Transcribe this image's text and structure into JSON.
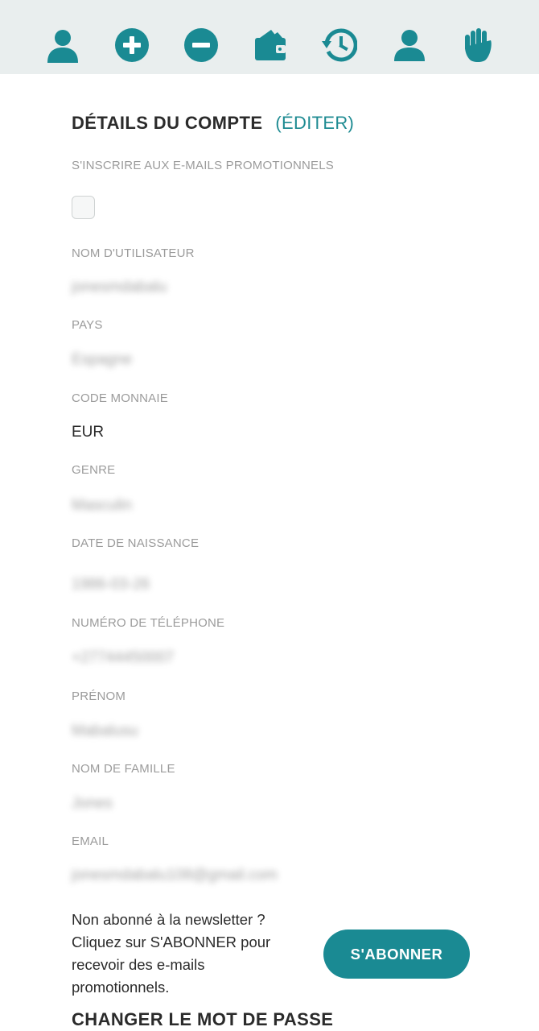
{
  "nav": {
    "icons": [
      {
        "name": "profile-icon"
      },
      {
        "name": "deposit-plus-icon"
      },
      {
        "name": "withdraw-minus-icon"
      },
      {
        "name": "wallet-icon"
      },
      {
        "name": "history-icon"
      },
      {
        "name": "account-user-icon"
      },
      {
        "name": "responsible-gaming-hand-icon"
      }
    ],
    "accent_color": "#1a8a93"
  },
  "account": {
    "title": "DÉTAILS DU COMPTE",
    "edit_label": "(ÉDITER)",
    "promo_label": "S'INSCRIRE AUX E-MAILS PROMOTIONNELS",
    "promo_checked": false,
    "fields": [
      {
        "label": "NOM D'UTILISATEUR",
        "value": "jonesmdabalu"
      },
      {
        "label": "PAYS",
        "value": "Espagne"
      },
      {
        "label": "CODE MONNAIE",
        "value": "EUR"
      },
      {
        "label": "GENRE",
        "value": "Masculin"
      },
      {
        "label": "DATE DE NAISSANCE",
        "value": "1986-03-26"
      },
      {
        "label": "NUMÉRO DE TÉLÉPHONE",
        "value": "+27744450007"
      },
      {
        "label": "PRÉNOM",
        "value": "Mabalusu"
      },
      {
        "label": "NOM DE FAMILLE",
        "value": "Jones"
      },
      {
        "label": "EMAIL",
        "value": "jonesmdabalu108@gmail.com"
      }
    ]
  },
  "newsletter": {
    "text_line1": "Non abonné à la newsletter ?",
    "text_line2": "Cliquez sur S'ABONNER pour",
    "text_line3": "recevoir des e-mails",
    "text_line4": "promotionnels.",
    "subscribe_label": "S'ABONNER"
  },
  "password": {
    "title": "CHANGER LE MOT DE PASSE"
  }
}
